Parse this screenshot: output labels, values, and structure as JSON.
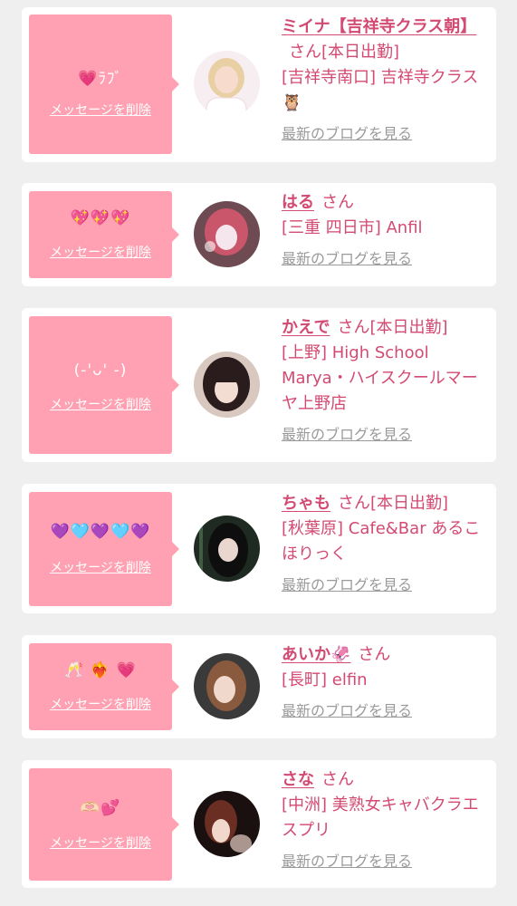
{
  "delete_label": "メッセージを削除",
  "blog_label": "最新のブログを見る",
  "honorific": "さん",
  "colors": {
    "bubble": "#ffa1b2",
    "name": "#d34a72",
    "link_gray": "#9a9a9a",
    "background": "#efefef"
  },
  "items": [
    {
      "message": "💗ﾗﾌﾞ",
      "name": "ミイナ【吉祥寺クラス朝】",
      "status": "[本日出勤]",
      "shop": "[吉祥寺南口] 吉祥寺クラス🦉",
      "avatar_icon": "blonde-woman-avatar"
    },
    {
      "message": "💖💖💖",
      "name": "はる",
      "status": "",
      "shop": "[三重 四日市] Anfil",
      "avatar_icon": "pink-hair-avatar"
    },
    {
      "message": "(-'ᴗ' -)",
      "name": "かえで",
      "status": "[本日出勤]",
      "shop": "[上野] High School Marya・ハイスクールマーヤ上野店",
      "avatar_icon": "dark-hair-avatar"
    },
    {
      "message": "💜🩵💜🩵💜",
      "name": "ちゃも",
      "status": "[本日出勤]",
      "shop": "[秋葉原] Cafe&Bar あるこほりっく",
      "avatar_icon": "black-hair-avatar"
    },
    {
      "message": "🥂 ❤️‍🔥 💗",
      "name": "あいか🦑",
      "status": "",
      "shop": "[長町] elfin",
      "avatar_icon": "brown-hair-avatar"
    },
    {
      "message": "🫶🏻💕",
      "name": "さな",
      "status": "",
      "shop": "[中洲] 美熟女キャバクラエスプリ",
      "avatar_icon": "updo-hair-avatar"
    }
  ]
}
